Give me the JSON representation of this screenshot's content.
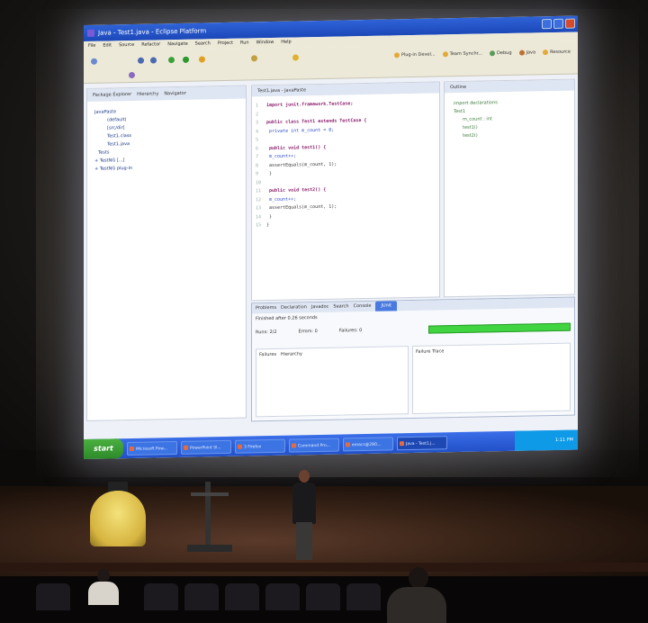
{
  "window": {
    "title": "Java - Test1.java - Eclipse Platform"
  },
  "menu": [
    "File",
    "Edit",
    "Source",
    "Refactor",
    "Navigate",
    "Search",
    "Project",
    "Run",
    "Window",
    "Help"
  ],
  "perspectives": [
    "Plug-in Devel...",
    "Team Synchr...",
    "Debug",
    "Java",
    "Resource"
  ],
  "package_explorer": {
    "tabs": [
      "Package Explorer",
      "Hierarchy",
      "Navigator"
    ],
    "tree": [
      "JavaPaste",
      "(default)",
      "[src/dir]",
      "Test1.class",
      "Test1.java",
      "Tests",
      "+ TestNG [...]",
      "+ TestNG plug-in"
    ]
  },
  "editor": {
    "tab": "Test1.java - JavaPaste",
    "lines": [
      "import junit.framework.TestCase;",
      "",
      "public class Test1 extends TestCase {",
      "  private int m_count = 0;",
      "",
      "  public void test1() {",
      "    m_count++;",
      "    assertEquals(m_count, 1);",
      "  }",
      "",
      "  public void test2() {",
      "    m_count++;",
      "    assertEquals(m_count, 1);",
      "  }",
      "}"
    ]
  },
  "outline": {
    "tab": "Outline",
    "tree": [
      "import declarations",
      "Test1",
      "m_count : int",
      "test1()",
      "test2()"
    ]
  },
  "bottom_panel": {
    "tabs": [
      "Problems",
      "Declaration",
      "Javadoc",
      "Search",
      "Console"
    ],
    "active_tab": "JUnit",
    "status": "Finished after 0.26 seconds",
    "runs_label": "Runs:",
    "runs_value": "2/2",
    "errors_label": "Errors:",
    "errors_value": "0",
    "failures_label": "Failures:",
    "failures_value": "0",
    "progress_color": "#41d441",
    "results_tabs": [
      "Failures",
      "Hierarchy"
    ],
    "trace_label": "Failure Trace"
  },
  "taskbar": {
    "start_label": "start",
    "items": [
      "Microsoft Pow...",
      "PowerPoint Sl...",
      "3 Firefox",
      "Command Pro...",
      "emacs@280...",
      "Java - Test1.j..."
    ],
    "active_item": 5,
    "clock": "1:11 PM"
  }
}
